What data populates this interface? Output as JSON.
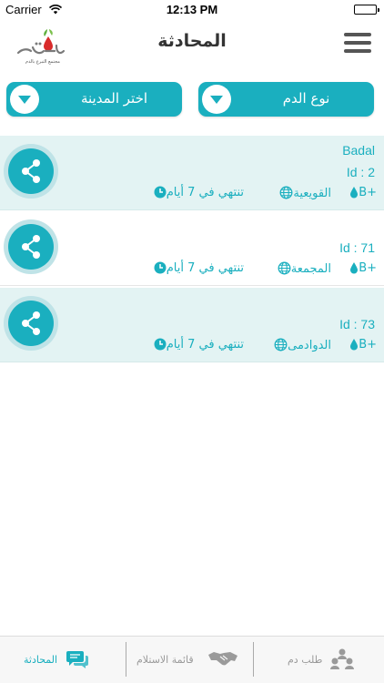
{
  "status_bar": {
    "carrier": "Carrier",
    "time": "12:13 PM"
  },
  "nav": {
    "title": "المحادثة",
    "logo_text": "قطرات",
    "logo_subtitle": "مجتمع التبرع بالدم"
  },
  "filters": {
    "blood_type_label": "نوع الدم",
    "city_label": "اختر المدينة"
  },
  "cards": [
    {
      "name": "Badal",
      "id": "Id : 2",
      "blood": "B+",
      "location": "القويعية",
      "expiry": "تنتهي في 7 أيام"
    },
    {
      "name": "",
      "id": "Id : 71",
      "blood": "B+",
      "location": "المجمعة",
      "expiry": "تنتهي في 7 أيام"
    },
    {
      "name": "",
      "id": "Id : 73",
      "blood": "B+",
      "location": "الدوادمى",
      "expiry": "تنتهي في 7 أيام"
    }
  ],
  "tabs": [
    {
      "label": "المحادثة",
      "icon": "chat-icon",
      "active": true
    },
    {
      "label": "قائمة الاستلام",
      "icon": "handshake-icon",
      "active": false
    },
    {
      "label": "طلب دم",
      "icon": "people-icon",
      "active": false
    }
  ],
  "colors": {
    "accent": "#1aafbf",
    "card_bg": "#e3f3f3",
    "inactive": "#9a9a9a"
  }
}
